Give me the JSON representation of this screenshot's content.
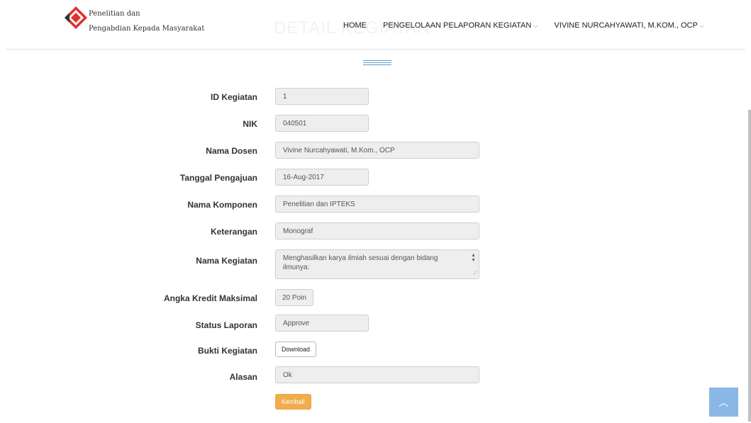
{
  "brand": {
    "line1": "Penelitian dan",
    "line2": "Pengabdian Kepada Masyarakat"
  },
  "ghost_title": "DETAIL KEGIATAN",
  "nav": {
    "home": "HOME",
    "reporting": "PENGELOLAAN PELAPORAN KEGIATAN",
    "user": "VIVINE NURCAHYAWATI, M.KOM., OCP"
  },
  "form": {
    "id_kegiatan": {
      "label": "ID Kegiatan",
      "value": "1"
    },
    "nik": {
      "label": "NIK",
      "value": "040501"
    },
    "nama_dosen": {
      "label": "Nama Dosen",
      "value": "Vivine Nurcahyawati, M.Kom., OCP"
    },
    "tanggal_pengajuan": {
      "label": "Tanggal Pengajuan",
      "value": "16-Aug-2017"
    },
    "nama_komponen": {
      "label": "Nama Komponen",
      "value": "Penelitian dan IPTEKS"
    },
    "keterangan": {
      "label": "Keterangan",
      "value": "Monograf"
    },
    "nama_kegiatan": {
      "label": "Nama Kegiatan",
      "value": "Menghasilkan karya ilmiah sesuai dengan bidang ilmunya:"
    },
    "angka_kredit": {
      "label": "Angka Kredit Maksimal",
      "value": "20 Poin"
    },
    "status_laporan": {
      "label": "Status Laporan",
      "value": "Approve"
    },
    "bukti_kegiatan": {
      "label": "Bukti Kegiatan",
      "button": "Download"
    },
    "alasan": {
      "label": "Alasan",
      "value": "Ok"
    },
    "kembali_button": "Kembali"
  },
  "colors": {
    "accent_blue": "#8ab8e6",
    "button_orange": "#f0ad4e"
  },
  "icons": {
    "scroll_top": "chevron-up-icon",
    "logo": "red-diamond-logo-icon"
  }
}
